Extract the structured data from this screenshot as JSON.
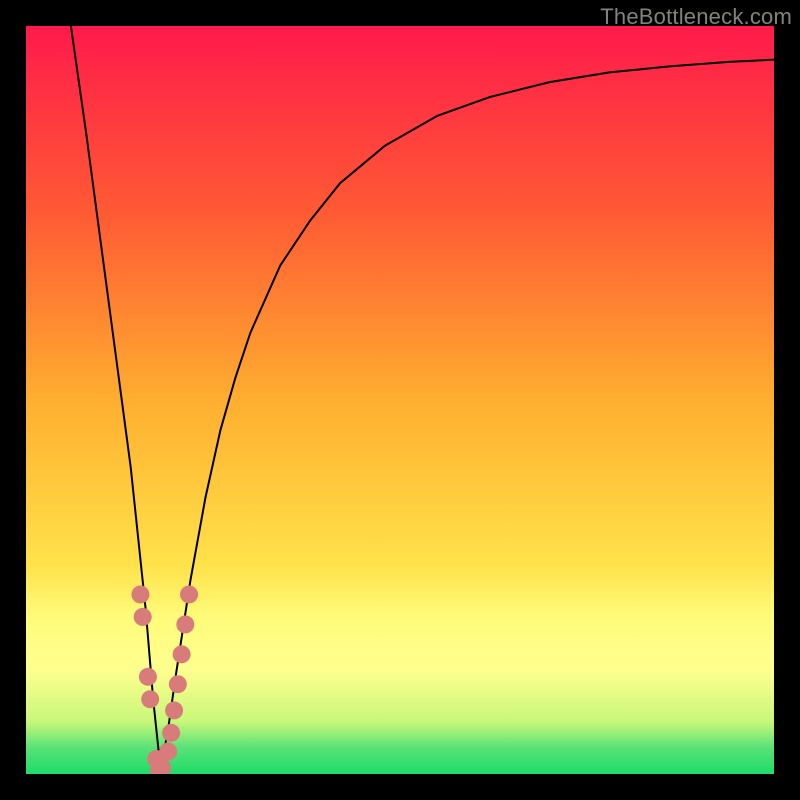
{
  "watermark": "TheBottleneck.com",
  "colors": {
    "bg_black": "#000000",
    "grad_top": "#ff1a4b",
    "grad_mid1": "#ff6a2e",
    "grad_mid2": "#ffd43a",
    "grad_yellow_band_top": "#fffb7a",
    "grad_yellow_band_bot": "#ffff8e",
    "grad_green": "#1edc6a",
    "curve_stroke": "#000000",
    "marker_fill": "#d87b7b"
  },
  "chart_data": {
    "type": "line",
    "title": "",
    "xlabel": "",
    "ylabel": "",
    "xlim": [
      0,
      100
    ],
    "ylim": [
      0,
      100
    ],
    "grid": false,
    "legend": false,
    "series": [
      {
        "name": "bottleneck-curve",
        "comment": "Black V-shaped curve. Values estimated from pixel positions; y is percent (0=bottom/green, 100=top/red).",
        "x": [
          6,
          8,
          10,
          12,
          14,
          16,
          17,
          18,
          19,
          20,
          22,
          24,
          26,
          28,
          30,
          34,
          38,
          42,
          48,
          55,
          62,
          70,
          78,
          86,
          94,
          100
        ],
        "y": [
          100,
          86,
          71,
          56,
          41,
          22,
          10,
          0.5,
          6,
          13,
          26,
          37,
          46,
          53,
          59,
          68,
          74,
          79,
          84,
          88,
          90.5,
          92.5,
          93.8,
          94.6,
          95.2,
          95.5
        ]
      }
    ],
    "markers": {
      "comment": "Pink dotted markers near the valley of the curve. Values estimated from pixels.",
      "points": [
        {
          "x": 15.3,
          "y": 24.0
        },
        {
          "x": 15.6,
          "y": 21.0
        },
        {
          "x": 16.3,
          "y": 13.0
        },
        {
          "x": 16.6,
          "y": 10.0
        },
        {
          "x": 17.4,
          "y": 2.0
        },
        {
          "x": 17.8,
          "y": 0.5
        },
        {
          "x": 18.2,
          "y": 0.8
        },
        {
          "x": 19.0,
          "y": 3.0
        },
        {
          "x": 19.4,
          "y": 5.5
        },
        {
          "x": 19.8,
          "y": 8.5
        },
        {
          "x": 20.3,
          "y": 12.0
        },
        {
          "x": 20.8,
          "y": 16.0
        },
        {
          "x": 21.3,
          "y": 20.0
        },
        {
          "x": 21.8,
          "y": 24.0
        }
      ]
    },
    "background_gradient": {
      "comment": "Vertical gradient from red (top) through orange/yellow to green (bottom) with a pale-yellow band near the bottom.",
      "stops": [
        {
          "pos": 0.0,
          "color": "#ff1a4b"
        },
        {
          "pos": 0.25,
          "color": "#ff5a34"
        },
        {
          "pos": 0.5,
          "color": "#ffae2f"
        },
        {
          "pos": 0.72,
          "color": "#ffe24a"
        },
        {
          "pos": 0.79,
          "color": "#fffb7a"
        },
        {
          "pos": 0.86,
          "color": "#ffff8e"
        },
        {
          "pos": 0.93,
          "color": "#c8f77a"
        },
        {
          "pos": 0.965,
          "color": "#58e277"
        },
        {
          "pos": 1.0,
          "color": "#1edc6a"
        }
      ]
    }
  }
}
